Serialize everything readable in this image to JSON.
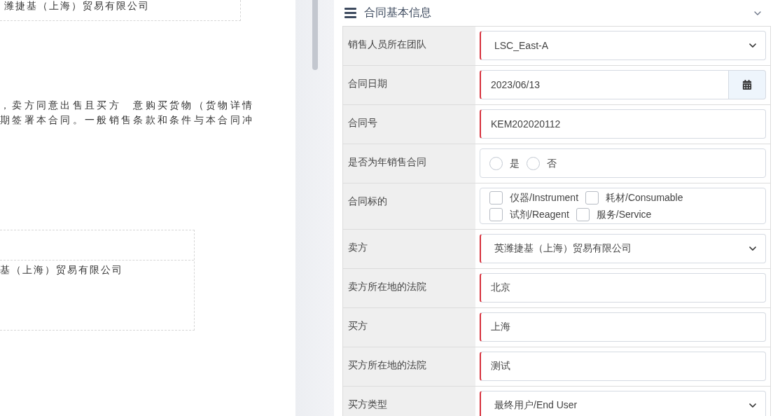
{
  "document": {
    "header_cell": "潍捷基（上海）贸易有限公司",
    "paragraph_lines": [
      "，卖方同意出售且买方　意购买货物（货物详情",
      "期签署本合同。一般销售条款和条件与本合同冲"
    ],
    "table_cell": "基（上海）贸易有限公司"
  },
  "form": {
    "title": "合同基本信息",
    "expanded": true,
    "rows": [
      {
        "label": "销售人员所在团队",
        "kind": "select",
        "required": true,
        "value": "LSC_East-A"
      },
      {
        "label": "合同日期",
        "kind": "date",
        "required": true,
        "value": "2023/06/13"
      },
      {
        "label": "合同号",
        "kind": "text",
        "required": true,
        "value": "KEM202020112"
      },
      {
        "label": "是否为年销售合同",
        "kind": "radio",
        "required": false,
        "options": [
          {
            "label": "是",
            "selected": false
          },
          {
            "label": "否",
            "selected": false
          }
        ]
      },
      {
        "label": "合同标的",
        "kind": "checkbox",
        "required": false,
        "options": [
          {
            "label": "仪器/Instrument",
            "checked": false
          },
          {
            "label": "耗材/Consumable",
            "checked": false
          },
          {
            "label": "试剂/Reagent",
            "checked": false
          },
          {
            "label": "服务/Service",
            "checked": false
          }
        ]
      },
      {
        "label": "卖方",
        "kind": "select",
        "required": true,
        "value": "英潍捷基（上海）贸易有限公司"
      },
      {
        "label": "卖方所在地的法院",
        "kind": "text",
        "required": true,
        "value": "北京"
      },
      {
        "label": "买方",
        "kind": "text",
        "required": true,
        "value": "上海"
      },
      {
        "label": "买方所在地的法院",
        "kind": "text",
        "required": true,
        "value": "测试"
      },
      {
        "label": "买方类型",
        "kind": "select",
        "required": true,
        "value": "最终用户/End User"
      }
    ]
  }
}
